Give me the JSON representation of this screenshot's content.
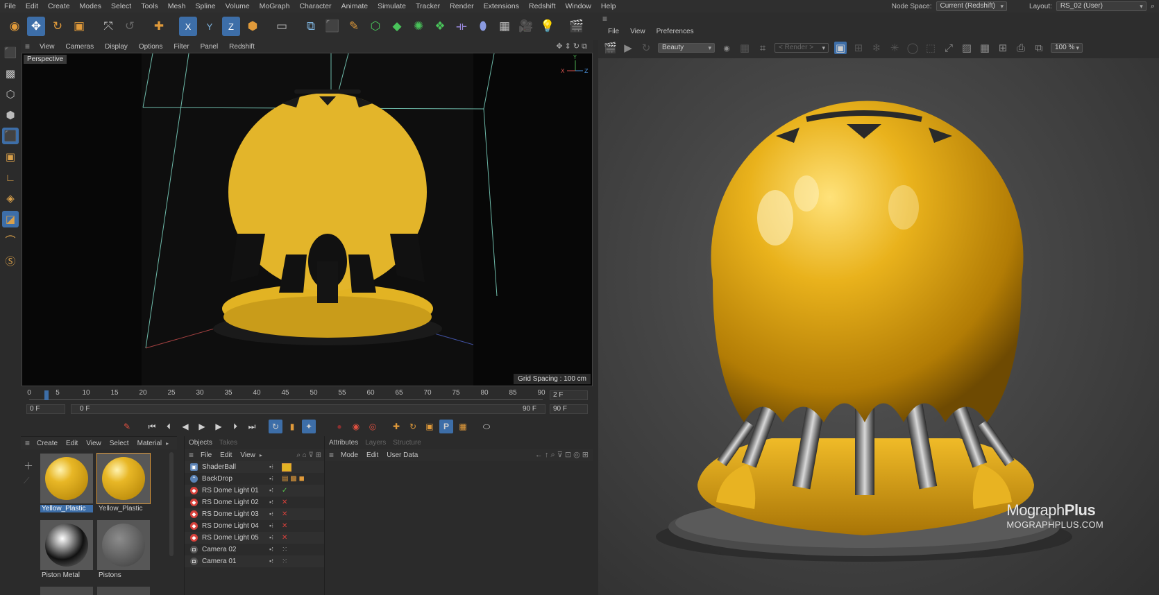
{
  "menubar": {
    "items": [
      "File",
      "Edit",
      "Create",
      "Modes",
      "Select",
      "Tools",
      "Mesh",
      "Spline",
      "Volume",
      "MoGraph",
      "Character",
      "Animate",
      "Simulate",
      "Tracker",
      "Render",
      "Extensions",
      "Redshift",
      "Window",
      "Help"
    ],
    "node_space_label": "Node Space:",
    "node_space_value": "Current (Redshift)",
    "layout_label": "Layout:",
    "layout_value": "RS_02 (User)"
  },
  "viewport": {
    "menu": [
      "View",
      "Cameras",
      "Display",
      "Options",
      "Filter",
      "Panel",
      "Redshift"
    ],
    "camera_label": "Perspective",
    "grid_spacing": "Grid Spacing : 100 cm"
  },
  "timeline": {
    "ticks": [
      "0",
      "5",
      "10",
      "15",
      "20",
      "25",
      "30",
      "35",
      "40",
      "45",
      "50",
      "55",
      "60",
      "65",
      "70",
      "75",
      "80",
      "85",
      "90"
    ],
    "current_frame": "2 F",
    "start_frame": "0 F",
    "range_start": "0 F",
    "range_end": "90 F",
    "end_frame": "90 F"
  },
  "material_manager": {
    "menu": [
      "Create",
      "Edit",
      "View",
      "Select",
      "Material"
    ],
    "materials": [
      {
        "name": "Yellow_Plastic",
        "selected": true,
        "color": "#e2b323"
      },
      {
        "name": "Yellow_Plastic",
        "selected": false,
        "color": "#e2b323"
      },
      {
        "name": "Piston Metal",
        "selected": false,
        "color": "#9a9a9a"
      },
      {
        "name": "Pistons",
        "selected": false,
        "color": "#6e6e6e"
      }
    ]
  },
  "object_manager": {
    "tabs": [
      "Objects",
      "Takes"
    ],
    "menu": [
      "File",
      "Edit",
      "View"
    ],
    "objects": [
      {
        "name": "ShaderBall",
        "status": ""
      },
      {
        "name": "BackDrop",
        "status": ""
      },
      {
        "name": "RS Dome Light 01",
        "status": "✓"
      },
      {
        "name": "RS Dome Light 02",
        "status": "✕"
      },
      {
        "name": "RS Dome Light 03",
        "status": "✕"
      },
      {
        "name": "RS Dome Light 04",
        "status": "✕"
      },
      {
        "name": "RS Dome Light 05",
        "status": "✕"
      },
      {
        "name": "Camera 02",
        "status": ""
      },
      {
        "name": "Camera 01",
        "status": ""
      }
    ]
  },
  "attributes": {
    "tabs": [
      "Attributes",
      "Layers",
      "Structure"
    ],
    "menu": [
      "Mode",
      "Edit",
      "User Data"
    ]
  },
  "render_view": {
    "menu": [
      "File",
      "View",
      "Preferences"
    ],
    "pass": "Beauty",
    "render_dropdown": "< Render >",
    "zoom": "100 %",
    "brand_name_light": "Mograph",
    "brand_name_bold": "Plus",
    "brand_url": "MOGRAPHPLUS.COM"
  },
  "colors": {
    "accent": "#3d6ea8",
    "ball_yellow": "#e2b323",
    "success": "#56c24a",
    "error": "#d8413b"
  }
}
